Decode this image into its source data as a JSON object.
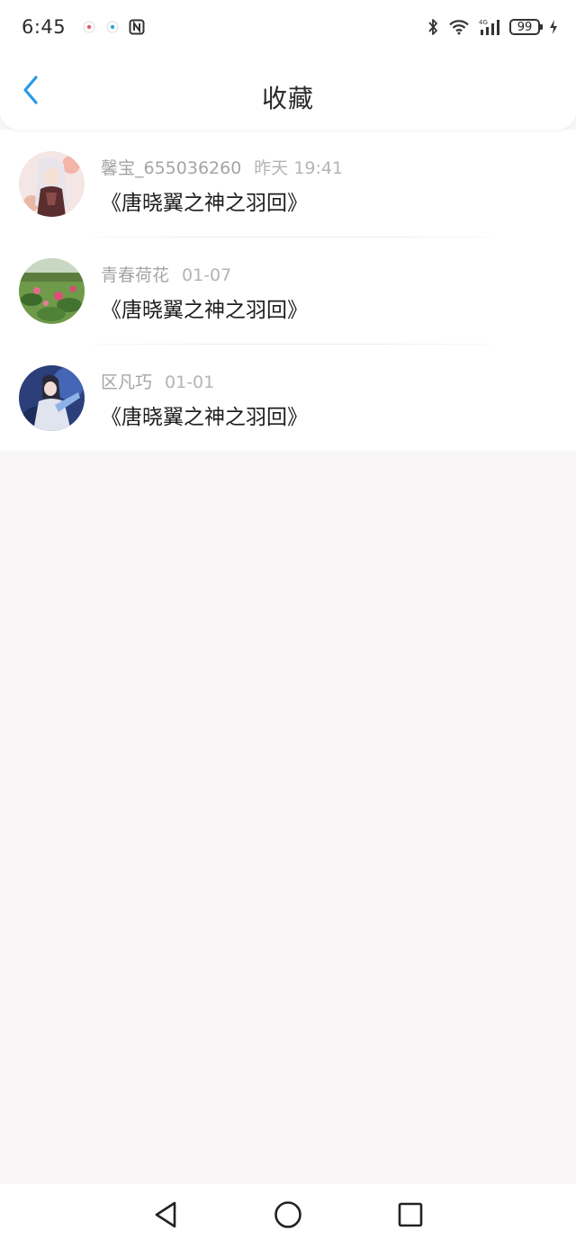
{
  "status_bar": {
    "time": "6:45",
    "battery": "99"
  },
  "header": {
    "title": "收藏",
    "back_icon": "chevron-left-icon",
    "accent_color": "#2b98e6"
  },
  "favorites": [
    {
      "user": "馨宝_655036260",
      "time": "昨天 19:41",
      "book": "《唐晓翼之神之羽回》"
    },
    {
      "user": "青春荷花",
      "time": "01-07",
      "book": "《唐晓翼之神之羽回》"
    },
    {
      "user": "区凡巧",
      "time": "01-01",
      "book": "《唐晓翼之神之羽回》"
    }
  ],
  "nav_bar": {
    "back_icon": "triangle-back-icon",
    "home_icon": "circle-home-icon",
    "recents_icon": "square-recents-icon"
  }
}
